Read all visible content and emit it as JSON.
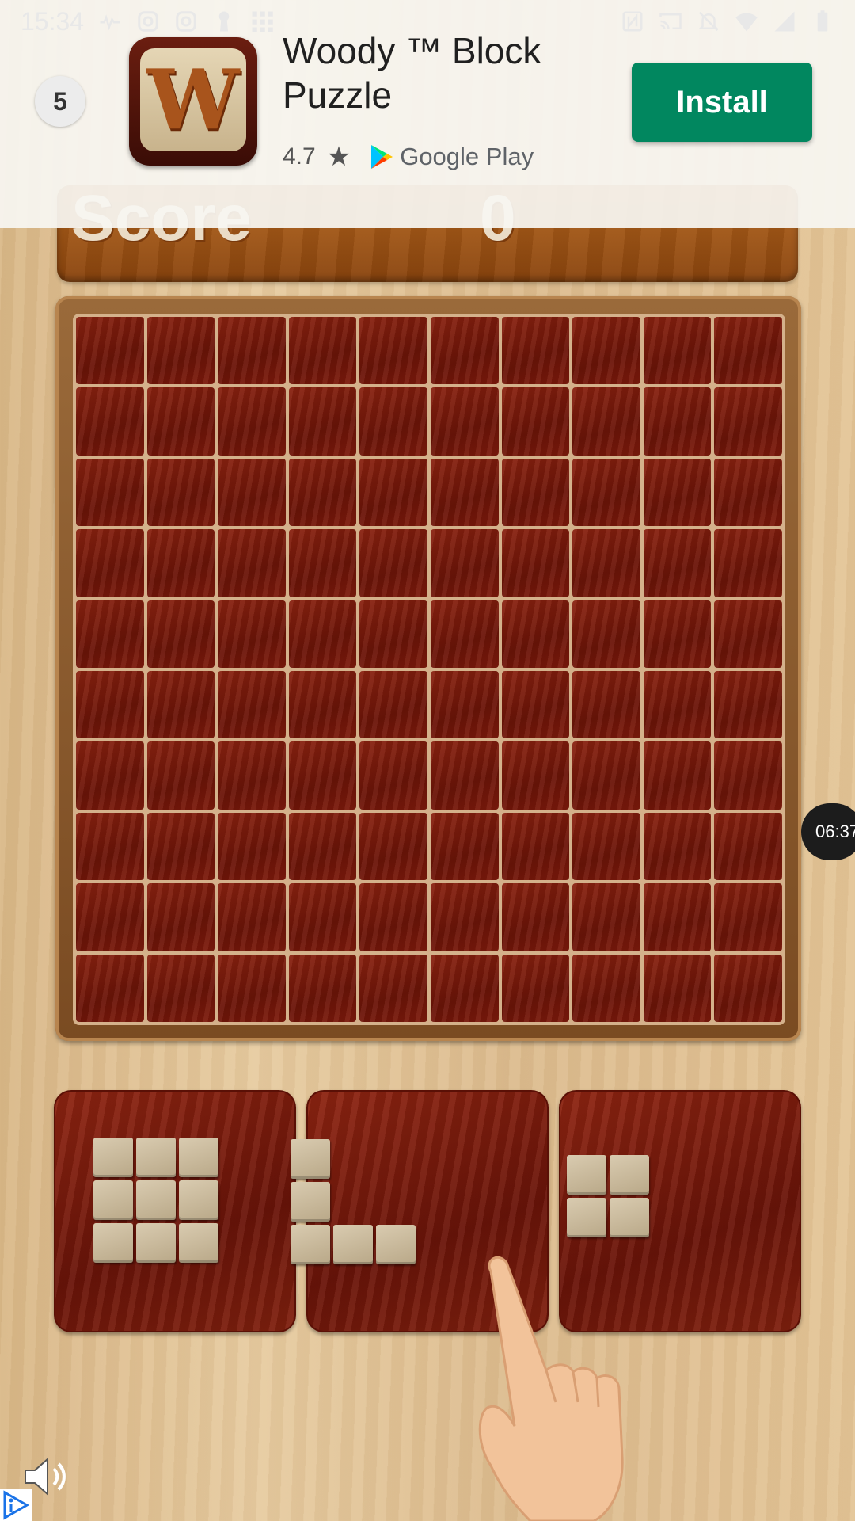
{
  "status_bar": {
    "time": "15:34",
    "left_icons": [
      "activity-icon",
      "instagram-icon",
      "instagram-icon",
      "keyhole-icon",
      "grid-dots-icon"
    ],
    "right_icons": [
      "nfc-icon",
      "cast-icon",
      "notifications-off-icon",
      "wifi-icon",
      "cell-signal-icon",
      "battery-icon"
    ]
  },
  "ad": {
    "countdown": "5",
    "app_title": "Woody ™ Block Puzzle",
    "app_icon_letter": "W",
    "rating": "4.7",
    "store_name": "Google Play",
    "install_label": "Install",
    "install_color": "#01875f"
  },
  "game": {
    "score_label": "Score",
    "score_value": "0",
    "board": {
      "rows": 10,
      "cols": 10,
      "filled_cells": 0
    },
    "pieces": [
      {
        "name": "3x3 square",
        "cells": [
          [
            0,
            0
          ],
          [
            0,
            1
          ],
          [
            0,
            2
          ],
          [
            1,
            0
          ],
          [
            1,
            1
          ],
          [
            1,
            2
          ],
          [
            2,
            0
          ],
          [
            2,
            1
          ],
          [
            2,
            2
          ]
        ]
      },
      {
        "name": "L shape",
        "cells": [
          [
            0,
            0
          ],
          [
            1,
            0
          ],
          [
            2,
            0
          ],
          [
            2,
            1
          ],
          [
            2,
            2
          ]
        ]
      },
      {
        "name": "2x2 square",
        "cells": [
          [
            0,
            0
          ],
          [
            0,
            1
          ],
          [
            1,
            0
          ],
          [
            1,
            1
          ]
        ]
      }
    ]
  },
  "overlay": {
    "timer": "06:37",
    "sound_icon": "speaker-icon",
    "adchoices_icon": "adchoices-icon"
  }
}
